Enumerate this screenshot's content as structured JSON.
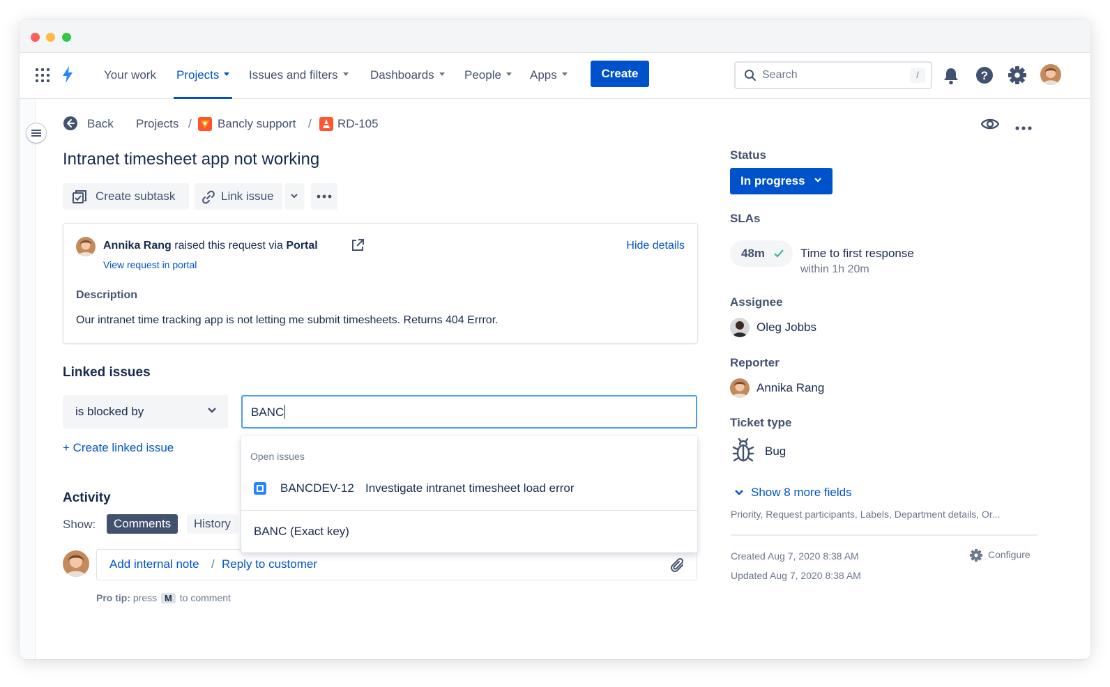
{
  "nav": {
    "items": [
      {
        "label": "Your work",
        "dropdown": false
      },
      {
        "label": "Projects",
        "dropdown": true,
        "active": true
      },
      {
        "label": "Issues and filters",
        "dropdown": true
      },
      {
        "label": "Dashboards",
        "dropdown": true
      },
      {
        "label": "People",
        "dropdown": true
      },
      {
        "label": "Apps",
        "dropdown": true
      }
    ],
    "create_label": "Create",
    "search_placeholder": "Search",
    "search_shortcut": "/"
  },
  "breadcrumb": {
    "back": "Back",
    "projects": "Projects",
    "project": "Bancly support",
    "issue_key": "RD-105",
    "separator": "/"
  },
  "issue": {
    "title": "Intranet timesheet app not working",
    "actions": {
      "create_subtask": "Create subtask",
      "link_issue": "Link issue"
    }
  },
  "request": {
    "requester": "Annika Rang",
    "raised_text": "raised this request via",
    "channel": "Portal",
    "view_link": "View request in portal",
    "hide_details": "Hide details",
    "description_heading": "Description",
    "description": "Our intranet time tracking app is not letting me submit timesheets. Returns 404 Errror."
  },
  "linked": {
    "heading": "Linked issues",
    "relation": "is blocked by",
    "query": "BANC",
    "create_link": "+ Create linked issue",
    "dropdown": {
      "group_label": "Open issues",
      "option_key": "BANCDEV-12",
      "option_summary": "Investigate intranet timesheet load error",
      "exact_key": "BANC (Exact key)"
    }
  },
  "activity": {
    "heading": "Activity",
    "show_label": "Show:",
    "tabs": [
      "Comments",
      "History"
    ],
    "add_note": "Add internal note",
    "separator": "/",
    "reply": "Reply to customer",
    "protip_prefix": "Pro tip:",
    "protip_press": "press",
    "protip_key": "M",
    "protip_suffix": "to comment"
  },
  "sidebar": {
    "status_label": "Status",
    "status_value": "In progress",
    "sla_label": "SLAs",
    "sla_time": "48m",
    "sla_title": "Time to first response",
    "sla_sub": "within 1h 20m",
    "assignee_label": "Assignee",
    "assignee": "Oleg Jobbs",
    "reporter_label": "Reporter",
    "reporter": "Annika Rang",
    "ticket_type_label": "Ticket type",
    "ticket_type": "Bug",
    "more_fields": "Show 8 more fields",
    "more_fields_list": "Priority, Request participants, Labels, Department details, Or...",
    "created": "Created Aug 7, 2020 8:38 AM",
    "updated": "Updated Aug 7, 2020 8:38 AM",
    "configure": "Configure"
  },
  "colors": {
    "brand": "#0052cc",
    "focus": "#4c9aff",
    "text": "#172b4d",
    "subtle": "#6b778c",
    "success": "#36b37e"
  },
  "icons": [
    "app-switcher-icon",
    "jira-logo-icon",
    "search-icon",
    "bell-icon",
    "help-icon",
    "gear-icon",
    "back-arrow-icon",
    "project-avatar-icon",
    "issue-type-icon",
    "eye-icon",
    "more-icon",
    "subtask-icon",
    "link-icon",
    "chevron-down-icon",
    "external-link-icon",
    "check-icon",
    "bug-icon",
    "attachment-icon",
    "task-icon"
  ]
}
